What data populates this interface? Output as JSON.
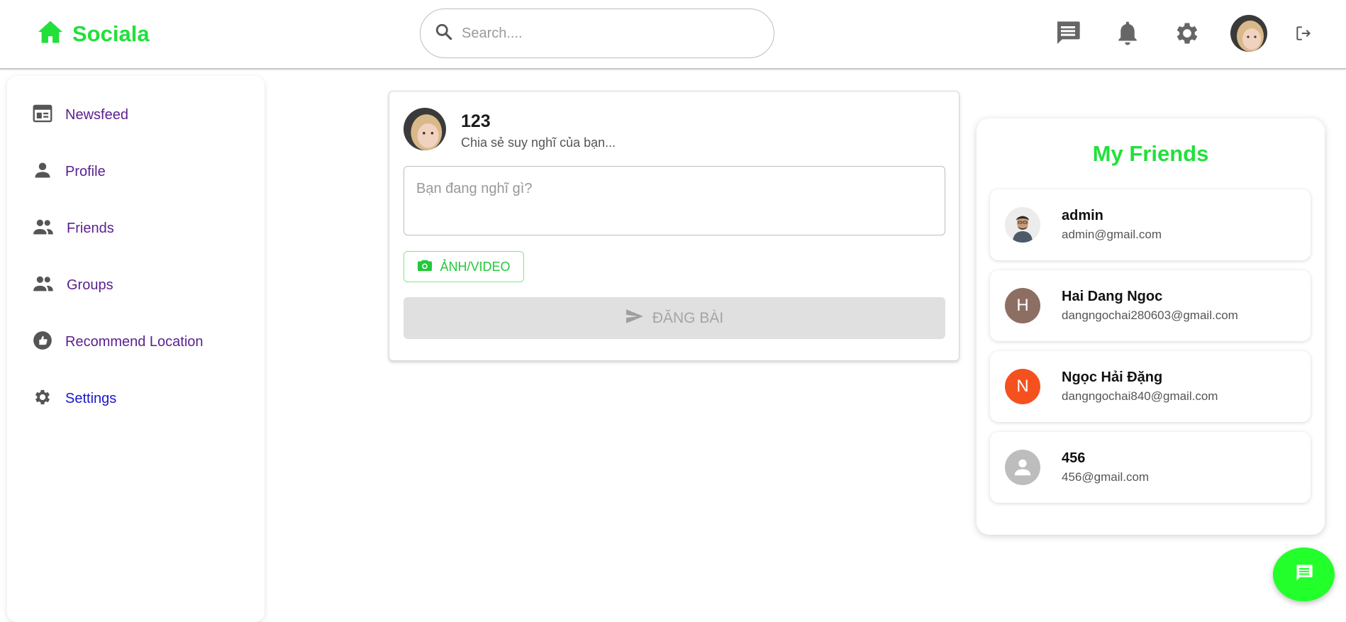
{
  "header": {
    "brand": "Sociala",
    "search_placeholder": "Search....",
    "icons": [
      "home-icon",
      "search-icon",
      "chat-icon",
      "bell-icon",
      "gear-icon",
      "avatar",
      "logout-icon"
    ]
  },
  "sidebar": {
    "items": [
      {
        "label": "Newsfeed",
        "icon": "newsfeed-icon"
      },
      {
        "label": "Profile",
        "icon": "person-icon"
      },
      {
        "label": "Friends",
        "icon": "people-icon"
      },
      {
        "label": "Groups",
        "icon": "people-icon"
      },
      {
        "label": "Recommend Location",
        "icon": "thumb-icon"
      },
      {
        "label": "Settings",
        "icon": "gear-icon"
      }
    ]
  },
  "composer": {
    "user_name": "123",
    "subtitle": "Chia sẻ suy nghĩ của bạn...",
    "placeholder": "Bạn đang nghĩ gì?",
    "media_label": "ẢNH/VIDEO",
    "submit_label": "ĐĂNG BÀI"
  },
  "friends": {
    "title": "My Friends",
    "list": [
      {
        "name": "admin",
        "email": "admin@gmail.com",
        "avatar": "photo"
      },
      {
        "name": "Hai Dang Ngoc",
        "email": "dangngochai280603@gmail.com",
        "avatar_letter": "H",
        "avatar_color": "#8d6e63"
      },
      {
        "name": "Ngọc Hải Đặng",
        "email": "dangngochai840@gmail.com",
        "avatar_letter": "N",
        "avatar_color": "#f4511e"
      },
      {
        "name": "456",
        "email": "456@gmail.com",
        "avatar": "default-person",
        "avatar_color": "#bdbdbd"
      }
    ]
  },
  "colors": {
    "brand_green": "#22e03a",
    "nav_purple": "#5b1f8f",
    "nav_active": "#1a17c8",
    "fab_green": "#22ff2a"
  }
}
